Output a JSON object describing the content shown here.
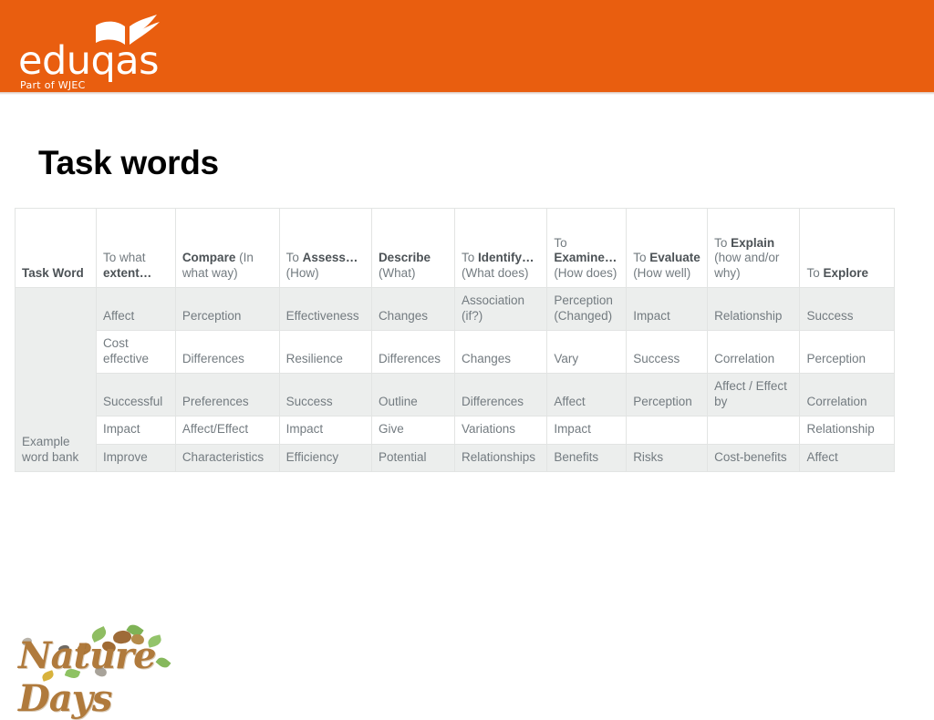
{
  "brand": {
    "logo_word": "eduqas",
    "logo_sub": "Part of WJEC",
    "logo_icon": "open-book-icon",
    "bar_color": "#E95E0F"
  },
  "slide": {
    "title": "Task words"
  },
  "footer": {
    "logo_text": "Nature Days",
    "logo_color": "#b07a3c"
  },
  "table": {
    "row_label_header": "Task Word",
    "row_label_body": "Example word bank",
    "headers": [
      {
        "prefix": "",
        "bold": "",
        "suffix": ""
      },
      {
        "prefix": "To what ",
        "bold": "extent…",
        "suffix": ""
      },
      {
        "prefix": "",
        "bold": "Compare",
        "suffix": " (In what way)"
      },
      {
        "prefix": "To ",
        "bold": "Assess…",
        "suffix": " (How)"
      },
      {
        "prefix": "",
        "bold": "Describe",
        "suffix": " (What)"
      },
      {
        "prefix": "To ",
        "bold": "Identify…",
        "suffix": " (What does)"
      },
      {
        "prefix": "To ",
        "bold": "Examine…",
        "suffix": " (How does)"
      },
      {
        "prefix": "To ",
        "bold": "Evaluate",
        "suffix": " (How well)"
      },
      {
        "prefix": "To ",
        "bold": "Explain",
        "suffix": " (how and/or why)"
      },
      {
        "prefix": "To ",
        "bold": "Explore",
        "suffix": ""
      }
    ],
    "rows": [
      {
        "shade": true,
        "cells": [
          "Affect",
          "Perception",
          "Effectiveness",
          "Changes",
          "Association (if?)",
          "Perception (Changed)",
          "Impact",
          "Relationship",
          "Success"
        ]
      },
      {
        "shade": false,
        "cells": [
          "Cost effective",
          "Differences",
          "Resilience",
          "Differences",
          "Changes",
          "Vary",
          "Success",
          "Correlation",
          "Perception"
        ]
      },
      {
        "shade": true,
        "cells": [
          "Successful",
          "Preferences",
          "Success",
          "Outline",
          "Differences",
          "Affect",
          "Perception",
          "Affect / Effect by",
          "Correlation"
        ]
      },
      {
        "shade": false,
        "cells": [
          "Impact",
          "Affect/Effect",
          "Impact",
          "Give",
          "Variations",
          "Impact",
          "",
          "",
          "Relationship"
        ]
      },
      {
        "shade": true,
        "cells": [
          "Improve",
          "Characteristics",
          "Efficiency",
          "Potential",
          "Relationships",
          "Benefits",
          "Risks",
          "Cost-benefits",
          "Affect"
        ]
      }
    ]
  }
}
